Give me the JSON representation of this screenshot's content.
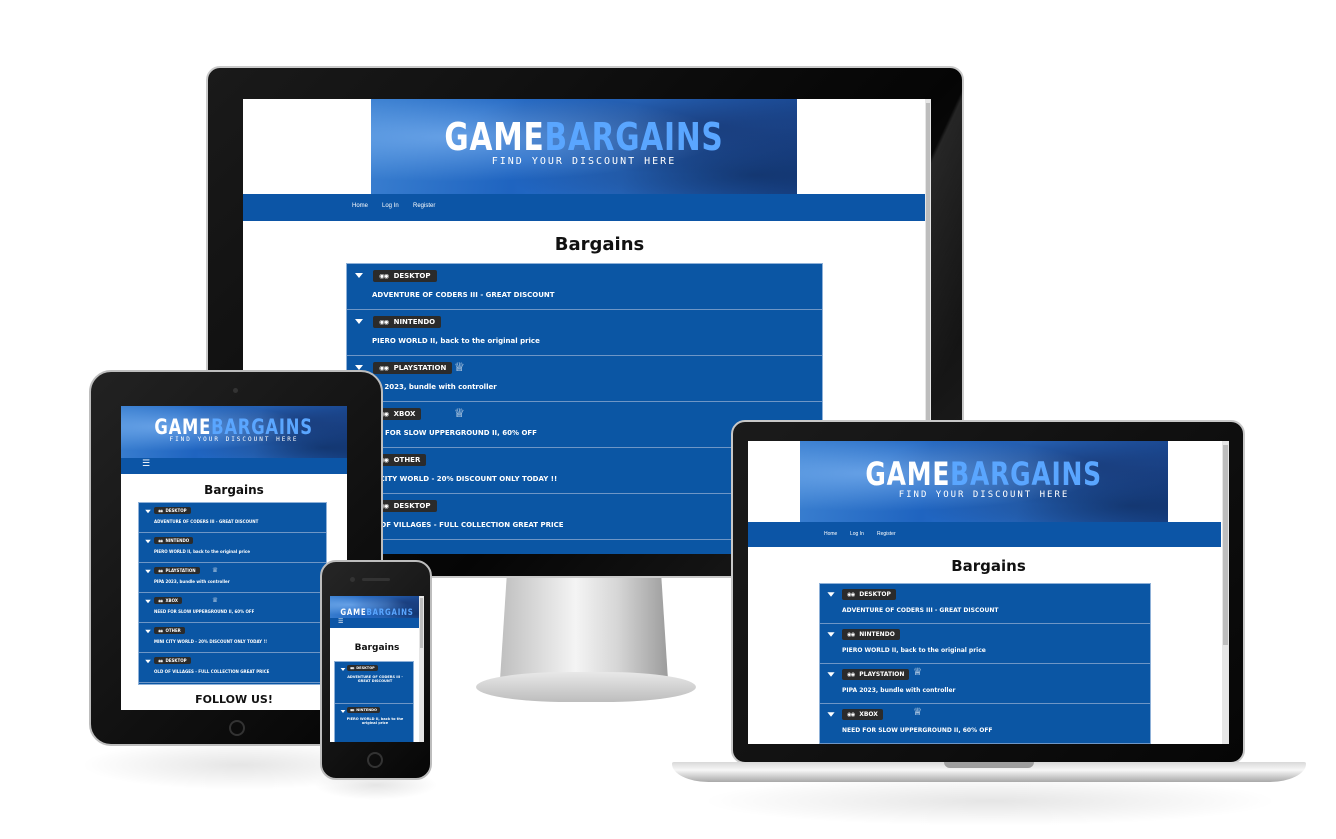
{
  "site": {
    "logo_game": "GAME",
    "logo_bargains": "BARGAINS",
    "tagline": "FIND YOUR DISCOUNT HERE",
    "nav": {
      "home": "Home",
      "login": "Log In",
      "register": "Register"
    },
    "menu_icon": "☰",
    "page_title": "Bargains",
    "follow_title": "FOLLOW US!",
    "controller_icon": "🎮",
    "award_icon": "ꕶ",
    "bargains": [
      {
        "platform": "DESKTOP",
        "title": "ADVENTURE OF CODERS III - GREAT DISCOUNT",
        "award": false
      },
      {
        "platform": "NINTENDO",
        "title": "PIERO WORLD II, back to the original price",
        "award": false
      },
      {
        "platform": "PLAYSTATION",
        "title": "PIPA 2023, bundle with controller",
        "award": true
      },
      {
        "platform": "XBOX",
        "title": "NEED FOR SLOW UPPERGROUND II, 60% OFF",
        "award": true
      },
      {
        "platform": "OTHER",
        "title": "MINI CITY WORLD - 20% DISCOUNT ONLY TODAY !!",
        "award": false
      },
      {
        "platform": "DESKTOP",
        "title": "OLD OF VILLAGES - FULL COLLECTION GREAT PRICE",
        "award": false
      }
    ],
    "monitor_titles": [
      "ADVENTURE OF CODERS III - GREAT DISCOUNT",
      "PIERO WORLD II, back to the original price",
      "PA 2023, bundle with controller",
      "ED FOR SLOW UPPERGROUND II, 60% OFF",
      "II CITY WORLD - 20% DISCOUNT ONLY TODAY !!",
      "D OF VILLAGES - FULL COLLECTION GREAT PRICE"
    ],
    "phone_titles": [
      "ADVENTURE OF CODERS III - GREAT DISCOUNT",
      "PIERO WORLD II, back to the original price"
    ]
  },
  "colors": {
    "brand_blue": "#0c55a6",
    "list_blue": "#0b56a4",
    "badge_dark": "#2b2b2b"
  }
}
